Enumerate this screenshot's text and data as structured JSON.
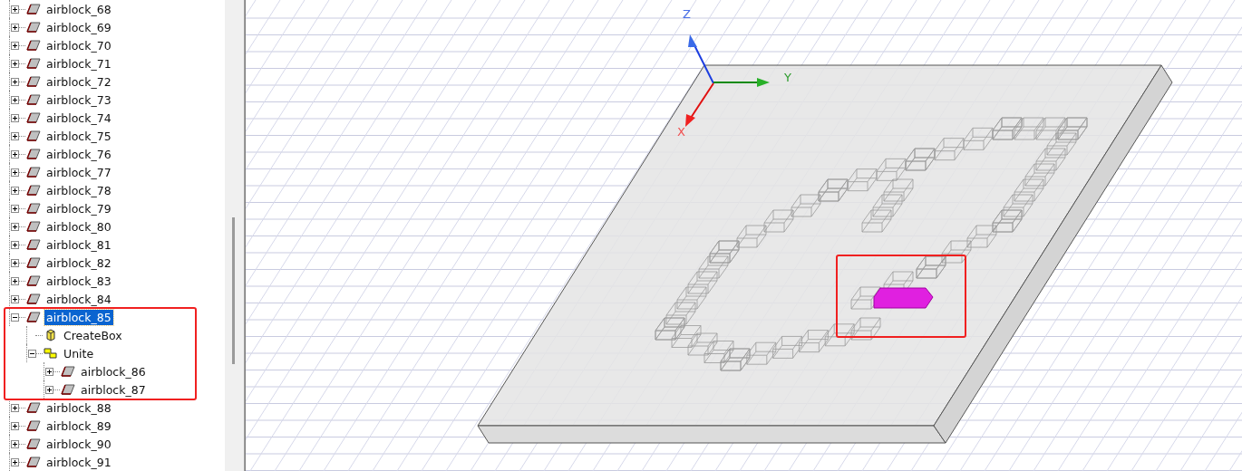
{
  "tree": {
    "items": [
      {
        "label": "airblock_68",
        "kind": "object",
        "expanded": false,
        "selected": false
      },
      {
        "label": "airblock_69",
        "kind": "object",
        "expanded": false,
        "selected": false
      },
      {
        "label": "airblock_70",
        "kind": "object",
        "expanded": false,
        "selected": false
      },
      {
        "label": "airblock_71",
        "kind": "object",
        "expanded": false,
        "selected": false
      },
      {
        "label": "airblock_72",
        "kind": "object",
        "expanded": false,
        "selected": false
      },
      {
        "label": "airblock_73",
        "kind": "object",
        "expanded": false,
        "selected": false
      },
      {
        "label": "airblock_74",
        "kind": "object",
        "expanded": false,
        "selected": false
      },
      {
        "label": "airblock_75",
        "kind": "object",
        "expanded": false,
        "selected": false
      },
      {
        "label": "airblock_76",
        "kind": "object",
        "expanded": false,
        "selected": false
      },
      {
        "label": "airblock_77",
        "kind": "object",
        "expanded": false,
        "selected": false
      },
      {
        "label": "airblock_78",
        "kind": "object",
        "expanded": false,
        "selected": false
      },
      {
        "label": "airblock_79",
        "kind": "object",
        "expanded": false,
        "selected": false
      },
      {
        "label": "airblock_80",
        "kind": "object",
        "expanded": false,
        "selected": false
      },
      {
        "label": "airblock_81",
        "kind": "object",
        "expanded": false,
        "selected": false
      },
      {
        "label": "airblock_82",
        "kind": "object",
        "expanded": false,
        "selected": false
      },
      {
        "label": "airblock_83",
        "kind": "object",
        "expanded": false,
        "selected": false
      },
      {
        "label": "airblock_84",
        "kind": "object",
        "expanded": false,
        "selected": false
      },
      {
        "label": "airblock_85",
        "kind": "object",
        "expanded": true,
        "selected": true,
        "children": [
          {
            "label": "CreateBox",
            "kind": "box",
            "selected": false
          },
          {
            "label": "Unite",
            "kind": "unite",
            "expanded": true,
            "selected": false,
            "children": [
              {
                "label": "airblock_86",
                "kind": "object",
                "expanded": false,
                "selected": false
              },
              {
                "label": "airblock_87",
                "kind": "object",
                "expanded": false,
                "selected": false
              }
            ]
          }
        ]
      },
      {
        "label": "airblock_88",
        "kind": "object",
        "expanded": false,
        "selected": false
      },
      {
        "label": "airblock_89",
        "kind": "object",
        "expanded": false,
        "selected": false
      },
      {
        "label": "airblock_90",
        "kind": "object",
        "expanded": false,
        "selected": false
      },
      {
        "label": "airblock_91",
        "kind": "object",
        "expanded": false,
        "selected": false
      }
    ]
  },
  "viewport": {
    "axes": [
      {
        "label": "Z"
      },
      {
        "label": "Y"
      },
      {
        "label": "X"
      }
    ]
  }
}
